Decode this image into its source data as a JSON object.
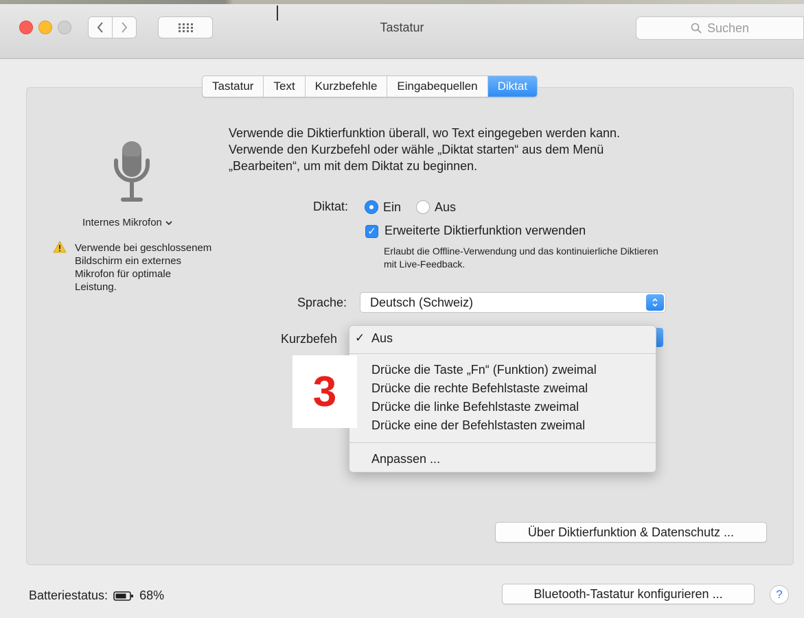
{
  "window": {
    "title": "Tastatur"
  },
  "search": {
    "placeholder": "Suchen"
  },
  "tabs": [
    {
      "label": "Tastatur",
      "active": false
    },
    {
      "label": "Text",
      "active": false
    },
    {
      "label": "Kurzbefehle",
      "active": false
    },
    {
      "label": "Eingabequellen",
      "active": false
    },
    {
      "label": "Diktat",
      "active": true
    }
  ],
  "left": {
    "mic_source": "Internes Mikrofon",
    "warning_lines": [
      "Verwende bei geschlossenem",
      "Bildschirm ein externes",
      "Mikrofon für optimale",
      "Leistung."
    ]
  },
  "intro_lines": [
    "Verwende die Diktierfunktion überall, wo Text eingegeben werden kann.",
    "Verwende den Kurzbefehl oder wähle „Diktat starten“ aus dem Menü",
    "„Bearbeiten“, um mit dem Diktat zu beginnen."
  ],
  "dictation": {
    "label": "Diktat:",
    "on_label": "Ein",
    "off_label": "Aus",
    "selected": "Ein"
  },
  "enhanced": {
    "label": "Erweiterte Diktierfunktion verwenden",
    "checked": true,
    "help_lines": [
      "Erlaubt die Offline-Verwendung und das kontinuierliche Diktieren",
      "mit Live-Feedback."
    ]
  },
  "language": {
    "label": "Sprache:",
    "value": "Deutsch (Schweiz)"
  },
  "shortcut": {
    "label": "Kurzbefeh",
    "menu": {
      "checked_item": "Aus",
      "options": [
        "Drücke die Taste „Fn“ (Funktion) zweimal",
        "Drücke die rechte Befehlstaste zweimal",
        "Drücke die linke Befehlstaste zweimal",
        "Drücke eine der Befehlstasten zweimal"
      ],
      "custom": "Anpassen ..."
    }
  },
  "annotation_badge": "3",
  "privacy_button": "Über Diktierfunktion & Datenschutz ...",
  "footer": {
    "battery_label": "Batteriestatus:",
    "battery_value": "68%",
    "bluetooth_button": "Bluetooth-Tastatur konfigurieren ...",
    "help": "?"
  },
  "colors": {
    "accent": "#2d8bf5",
    "badge_red": "#e8201b",
    "close": "#fc5f57",
    "minimize": "#fdbc2e"
  }
}
